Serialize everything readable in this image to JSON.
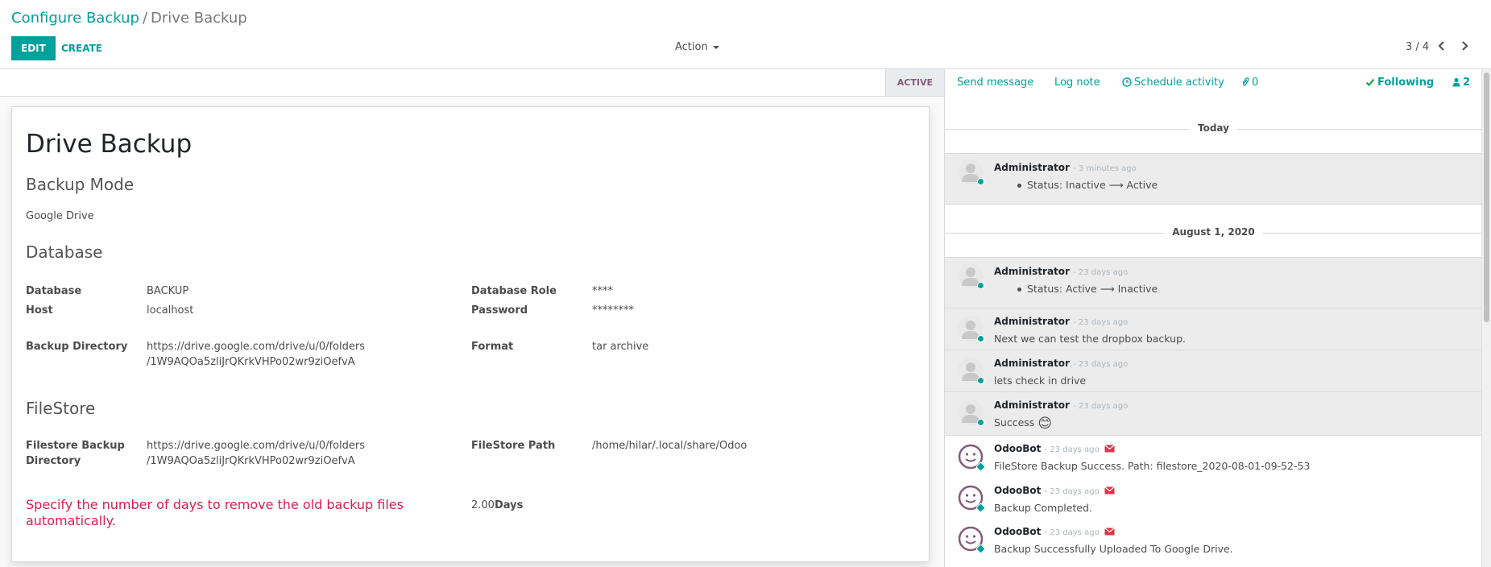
{
  "breadcrumb": {
    "parent": "Configure Backup",
    "separator": "/",
    "current": "Drive Backup"
  },
  "toolbar": {
    "edit_label": "EDIT",
    "create_label": "CREATE",
    "action_label": "Action"
  },
  "pager": {
    "value": "3 / 4"
  },
  "statusbar": {
    "state": "ACTIVE"
  },
  "form": {
    "title": "Drive Backup",
    "backup_mode_heading": "Backup Mode",
    "backup_mode_value": "Google Drive",
    "database_heading": "Database",
    "fields_left": [
      {
        "label": "Database",
        "value": "BACKUP"
      },
      {
        "label": "Host",
        "value": "localhost"
      },
      {
        "label": "Backup Directory",
        "value": "https://drive.google.com/drive/u/0/folders\n/1W9AQOa5zliJrQKrkVHPo02wr9ziOefvA"
      }
    ],
    "fields_right": [
      {
        "label": "Database Role",
        "value": "****"
      },
      {
        "label": "Password",
        "value": "********"
      },
      {
        "label": "Format",
        "value": "tar archive"
      }
    ],
    "filestore_heading": "FileStore",
    "filestore_dir_label": "Filestore Backup\nDirectory",
    "filestore_dir_value": "https://drive.google.com/drive/u/0/folders\n/1W9AQOa5zliJrQKrkVHPo02wr9ziOefvA",
    "filestore_path_label": "FileStore Path",
    "filestore_path_value": "/home/hilar/.local/share/Odoo",
    "remove_days_label": "Specify the number of days to remove the old backup files automatically.",
    "remove_days_value": "2.00",
    "remove_days_unit": "Days"
  },
  "chatter": {
    "send_message": "Send message",
    "log_note": "Log note",
    "schedule_activity": "Schedule activity",
    "attachments_count": "0",
    "following": "Following",
    "followers_count": "2",
    "date_today": "Today",
    "date_aug": "August 1, 2020",
    "messages": [
      {
        "author": "Administrator",
        "ago": "- 3 minutes ago",
        "tracking_field": "Status:",
        "old": "Inactive",
        "arrow": "⟶",
        "new": "Active"
      },
      {
        "author": "Administrator",
        "ago": "- 23 days ago",
        "tracking_field": "Status:",
        "old": "Active",
        "arrow": "⟶",
        "new": "Inactive"
      },
      {
        "author": "Administrator",
        "ago": "- 23 days ago",
        "body": "Next we can test the dropbox backup."
      },
      {
        "author": "Administrator",
        "ago": "- 23 days ago",
        "body": "lets check in drive"
      },
      {
        "author": "Administrator",
        "ago": "- 23 days ago",
        "body": "Success",
        "emoji": "😊"
      },
      {
        "author": "OdooBot",
        "ago": "- 23 days ago",
        "body": "FileStore Backup Success. Path: filestore_2020-08-01-09-52-53"
      },
      {
        "author": "OdooBot",
        "ago": "- 23 days ago",
        "body": "Backup Completed."
      },
      {
        "author": "OdooBot",
        "ago": "- 23 days ago",
        "body": "Backup Successfully Uploaded To Google Drive."
      }
    ]
  },
  "colors": {
    "primary": "#00A09D",
    "odoo_purple": "#875A7B",
    "danger": "#dc1c4d",
    "envelope": "#dc3545"
  }
}
